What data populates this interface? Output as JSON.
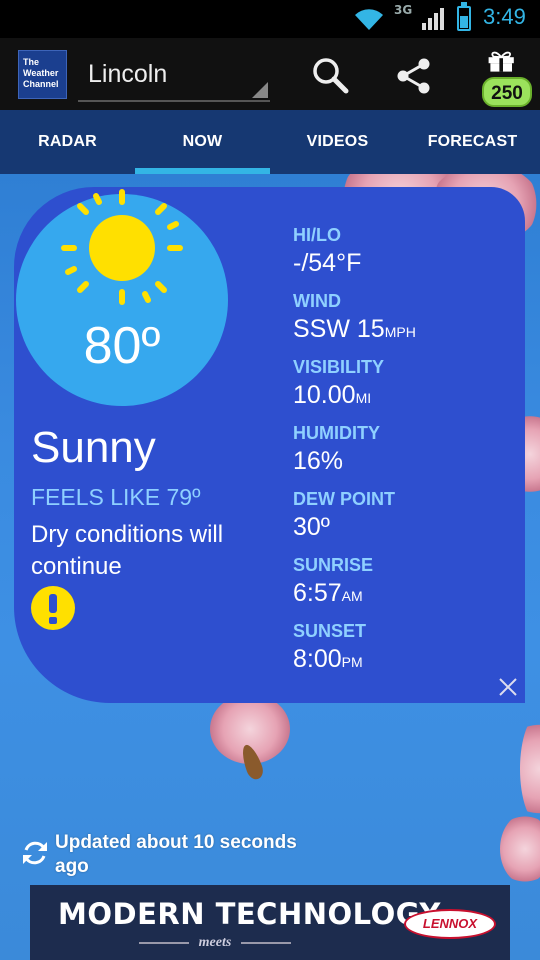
{
  "status_bar": {
    "network": "3G",
    "time": "3:49",
    "icons": [
      "wifi-icon",
      "signal-icon",
      "battery-icon"
    ]
  },
  "app_bar": {
    "logo_lines": [
      "The",
      "Weather",
      "Channel"
    ],
    "location": "Lincoln",
    "reward_count": "250",
    "icons": [
      "search-icon",
      "share-icon",
      "gift-icon"
    ]
  },
  "tabs": [
    {
      "label": "RADAR",
      "active": false
    },
    {
      "label": "NOW",
      "active": true
    },
    {
      "label": "VIDEOS",
      "active": false
    },
    {
      "label": "FORECAST",
      "active": false
    }
  ],
  "current": {
    "temperature": "80º",
    "condition": "Sunny",
    "feels_like": "FEELS LIKE 79º",
    "description": "Dry conditions will continue",
    "condition_icon": "sun-icon",
    "alert_icon": "alert-icon"
  },
  "stats": [
    {
      "label": "HI/LO",
      "value": "-/54°F",
      "unit": ""
    },
    {
      "label": "WIND",
      "value": "SSW 15",
      "unit": "MPH"
    },
    {
      "label": "VISIBILITY",
      "value": "10.00",
      "unit": "MI"
    },
    {
      "label": "HUMIDITY",
      "value": "16%",
      "unit": ""
    },
    {
      "label": "DEW POINT",
      "value": "30º",
      "unit": ""
    },
    {
      "label": "SUNRISE",
      "value": "6:57",
      "unit": "AM"
    },
    {
      "label": "SUNSET",
      "value": "8:00",
      "unit": "PM"
    }
  ],
  "updated_text": "Updated about 10 seconds ago",
  "ad": {
    "headline": "MODERN TECHNOLOGY",
    "subline": "meets",
    "brand": "LENNOX"
  },
  "colors": {
    "accent": "#33b5e5",
    "tab_bar": "#163872",
    "card": "#2e4fcf",
    "label_blue": "#8fd0ff",
    "sun": "#ffe000",
    "badge_green": "#9be25c"
  }
}
